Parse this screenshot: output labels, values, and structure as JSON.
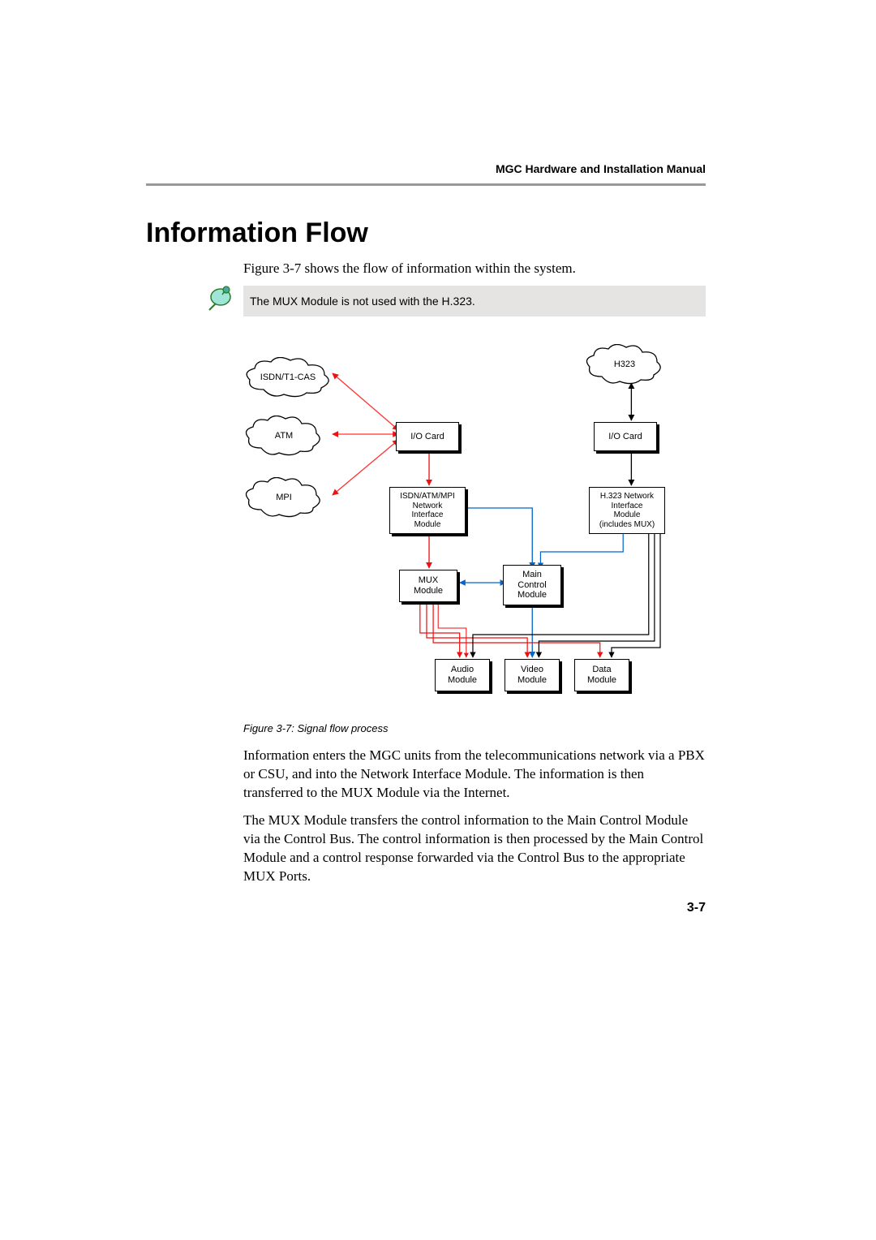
{
  "header": {
    "running": "MGC Hardware and Installation Manual"
  },
  "title": "Information Flow",
  "intro": "Figure 3-7 shows the flow of information within the system.",
  "note": "The MUX Module is not used with the H.323.",
  "caption": "Figure 3-7: Signal flow process",
  "para1": "Information enters the MGC units from the telecommunications network via a PBX or CSU, and into the Network Interface Module. The information is then transferred to the MUX Module via the Internet.",
  "para2": "The MUX Module transfers the control information to the Main Control Module via the Control Bus. The control information is then processed by the Main Control Module and a control response forwarded via the Control Bus to the appropriate MUX Ports.",
  "pagenum": "3-7",
  "diagram": {
    "clouds": {
      "isdn": "ISDN/T1-CAS",
      "atm": "ATM",
      "mpi": "MPI",
      "h323": "H323"
    },
    "boxes": {
      "io_left": "I/O Card",
      "io_right": "I/O Card",
      "nim_left_l1": "ISDN/ATM/MPI",
      "nim_left_l2": "Network",
      "nim_left_l3": "Interface",
      "nim_left_l4": "Module",
      "nim_right_l1": "H.323 Network",
      "nim_right_l2": "Interface",
      "nim_right_l3": "Module",
      "nim_right_l4": "(includes MUX)",
      "mux_l1": "MUX",
      "mux_l2": "Module",
      "mcm_l1": "Main",
      "mcm_l2": "Control",
      "mcm_l3": "Module",
      "audio_l1": "Audio",
      "audio_l2": "Module",
      "video_l1": "Video",
      "video_l2": "Module",
      "data_l1": "Data",
      "data_l2": "Module"
    }
  }
}
